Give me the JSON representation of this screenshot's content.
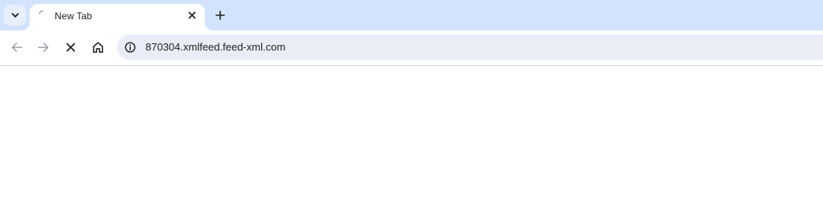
{
  "colors": {
    "tabstrip_bg": "#d3e3fd",
    "omnibox_bg": "#e9eef6",
    "icon_dark": "#1f1f1f",
    "icon_disabled": "#9aa0a6"
  },
  "tabstrip": {
    "tab_search_icon": "chevron-down-icon",
    "tabs": [
      {
        "title": "New Tab",
        "loading": true,
        "close_icon": "close-icon"
      }
    ],
    "new_tab_icon": "plus-icon"
  },
  "toolbar": {
    "back_icon": "arrow-left-icon",
    "forward_icon": "arrow-right-icon",
    "stop_icon": "stop-icon",
    "home_icon": "home-icon",
    "site_info_icon": "info-icon",
    "url": "870304.xmlfeed.feed-xml.com"
  }
}
